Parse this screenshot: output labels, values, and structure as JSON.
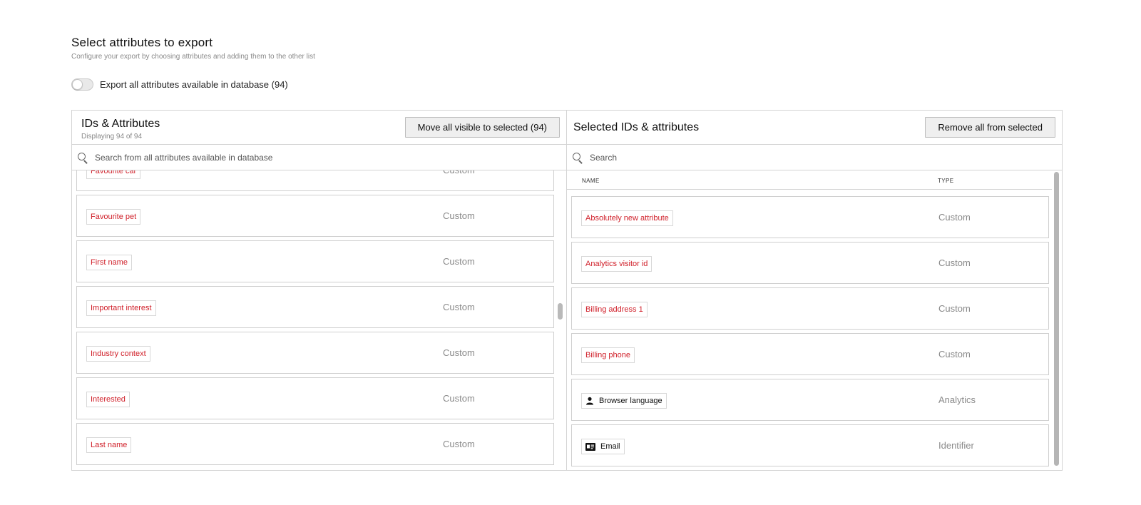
{
  "header": {
    "title": "Select attributes to export",
    "subtitle": "Configure your export by choosing attributes and adding them to the other list"
  },
  "export_all": {
    "label": "Export all attributes available in database (94)",
    "enabled": false
  },
  "left_panel": {
    "title": "IDs & Attributes",
    "count_text": "Displaying 94 of 94",
    "button_label": "Move all visible to selected (94)",
    "search_placeholder": "Search from all attributes available in database",
    "rows": [
      {
        "name": "Favourite car",
        "type": "Custom"
      },
      {
        "name": "Favourite pet",
        "type": "Custom"
      },
      {
        "name": "First name",
        "type": "Custom"
      },
      {
        "name": "Important interest",
        "type": "Custom"
      },
      {
        "name": "Industry context",
        "type": "Custom"
      },
      {
        "name": "Interested",
        "type": "Custom"
      },
      {
        "name": "Last name",
        "type": "Custom"
      }
    ]
  },
  "right_panel": {
    "title": "Selected IDs & attributes",
    "button_label": "Remove all from selected",
    "search_placeholder": "Search",
    "columns": {
      "name": "NAME",
      "type": "TYPE"
    },
    "rows": [
      {
        "name": "Absolutely new attribute",
        "type": "Custom",
        "icon": ""
      },
      {
        "name": "Analytics visitor id",
        "type": "Custom",
        "icon": ""
      },
      {
        "name": "Billing address 1",
        "type": "Custom",
        "icon": ""
      },
      {
        "name": "Billing phone",
        "type": "Custom",
        "icon": ""
      },
      {
        "name": "Browser language",
        "type": "Analytics",
        "icon": "person-icon"
      },
      {
        "name": "Email",
        "type": "Identifier",
        "icon": "id-card-icon"
      }
    ]
  },
  "colors": {
    "custom_tag_text": "#d0202a",
    "border": "#d4d4d4",
    "type_text": "#8a8a8a"
  }
}
